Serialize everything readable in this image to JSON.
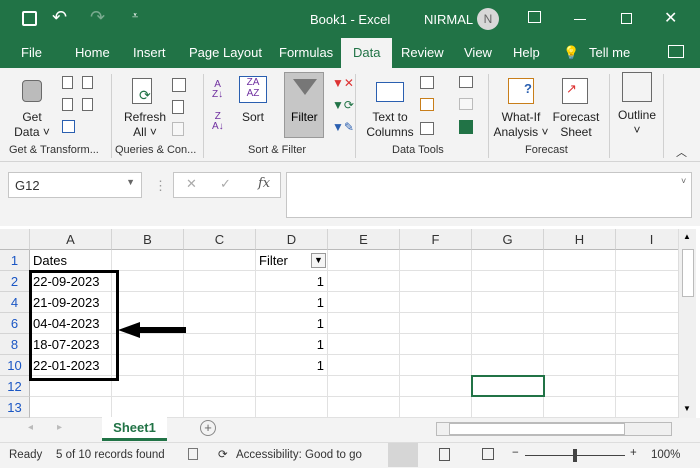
{
  "title_bar": {
    "doc_title": "Book1 - Excel",
    "user": "NIRMAL",
    "avatar_initial": "N"
  },
  "tabs": [
    "File",
    "Home",
    "Insert",
    "Page Layout",
    "Formulas",
    "Data",
    "Review",
    "View",
    "Help",
    "Tell me"
  ],
  "active_tab": "Data",
  "ribbon": {
    "get_data": [
      "Get",
      "Data"
    ],
    "refresh_all": [
      "Refresh",
      "All"
    ],
    "sort": "Sort",
    "filter": "Filter",
    "text_to_columns": [
      "Text to",
      "Columns"
    ],
    "what_if": [
      "What-If",
      "Analysis"
    ],
    "forecast_sheet": [
      "Forecast",
      "Sheet"
    ],
    "outline": "Outline",
    "groups": [
      "Get & Transform...",
      "Queries & Con...",
      "Sort & Filter",
      "Data Tools",
      "Forecast"
    ]
  },
  "formula_bar": {
    "name_box": "G12",
    "fx": "fx",
    "formula": ""
  },
  "columns": [
    "A",
    "B",
    "C",
    "D",
    "E",
    "F",
    "G",
    "H",
    "I"
  ],
  "rows": [
    {
      "num": "1",
      "a": "Dates",
      "d": "Filter"
    },
    {
      "num": "2",
      "a": "22-09-2023",
      "d": "1"
    },
    {
      "num": "4",
      "a": "21-09-2023",
      "d": "1"
    },
    {
      "num": "6",
      "a": "04-04-2023",
      "d": "1"
    },
    {
      "num": "8",
      "a": "18-07-2023",
      "d": "1"
    },
    {
      "num": "10",
      "a": "22-01-2023",
      "d": "1"
    },
    {
      "num": "12",
      "a": "",
      "d": ""
    },
    {
      "num": "13",
      "a": "",
      "d": ""
    }
  ],
  "sheet_tab": "Sheet1",
  "status": {
    "ready": "Ready",
    "records": "5 of 10 records found",
    "accessibility": "Accessibility: Good to go",
    "zoom": "100%"
  },
  "colors": {
    "excel_green": "#217346"
  }
}
